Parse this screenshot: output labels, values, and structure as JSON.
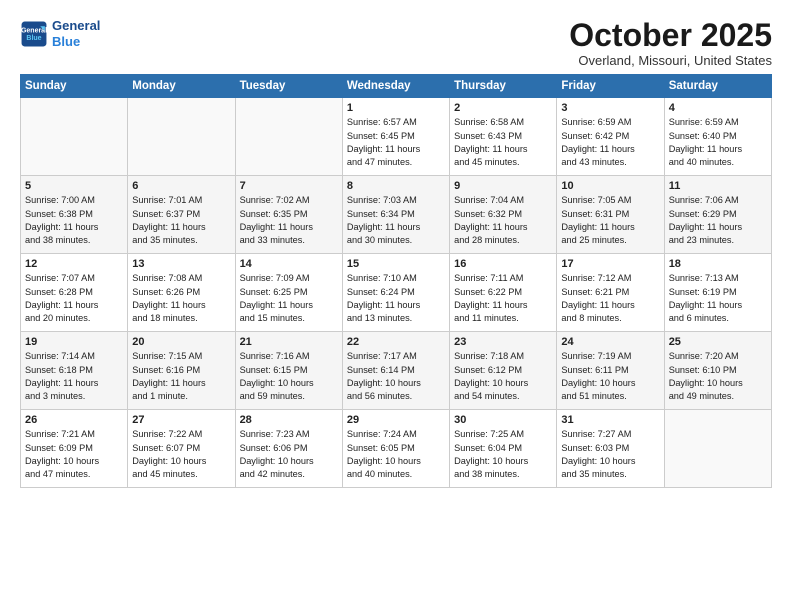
{
  "header": {
    "logo_line1": "General",
    "logo_line2": "Blue",
    "title": "October 2025",
    "location": "Overland, Missouri, United States"
  },
  "days_of_week": [
    "Sunday",
    "Monday",
    "Tuesday",
    "Wednesday",
    "Thursday",
    "Friday",
    "Saturday"
  ],
  "weeks": [
    [
      {
        "day": "",
        "info": ""
      },
      {
        "day": "",
        "info": ""
      },
      {
        "day": "",
        "info": ""
      },
      {
        "day": "1",
        "info": "Sunrise: 6:57 AM\nSunset: 6:45 PM\nDaylight: 11 hours\nand 47 minutes."
      },
      {
        "day": "2",
        "info": "Sunrise: 6:58 AM\nSunset: 6:43 PM\nDaylight: 11 hours\nand 45 minutes."
      },
      {
        "day": "3",
        "info": "Sunrise: 6:59 AM\nSunset: 6:42 PM\nDaylight: 11 hours\nand 43 minutes."
      },
      {
        "day": "4",
        "info": "Sunrise: 6:59 AM\nSunset: 6:40 PM\nDaylight: 11 hours\nand 40 minutes."
      }
    ],
    [
      {
        "day": "5",
        "info": "Sunrise: 7:00 AM\nSunset: 6:38 PM\nDaylight: 11 hours\nand 38 minutes."
      },
      {
        "day": "6",
        "info": "Sunrise: 7:01 AM\nSunset: 6:37 PM\nDaylight: 11 hours\nand 35 minutes."
      },
      {
        "day": "7",
        "info": "Sunrise: 7:02 AM\nSunset: 6:35 PM\nDaylight: 11 hours\nand 33 minutes."
      },
      {
        "day": "8",
        "info": "Sunrise: 7:03 AM\nSunset: 6:34 PM\nDaylight: 11 hours\nand 30 minutes."
      },
      {
        "day": "9",
        "info": "Sunrise: 7:04 AM\nSunset: 6:32 PM\nDaylight: 11 hours\nand 28 minutes."
      },
      {
        "day": "10",
        "info": "Sunrise: 7:05 AM\nSunset: 6:31 PM\nDaylight: 11 hours\nand 25 minutes."
      },
      {
        "day": "11",
        "info": "Sunrise: 7:06 AM\nSunset: 6:29 PM\nDaylight: 11 hours\nand 23 minutes."
      }
    ],
    [
      {
        "day": "12",
        "info": "Sunrise: 7:07 AM\nSunset: 6:28 PM\nDaylight: 11 hours\nand 20 minutes."
      },
      {
        "day": "13",
        "info": "Sunrise: 7:08 AM\nSunset: 6:26 PM\nDaylight: 11 hours\nand 18 minutes."
      },
      {
        "day": "14",
        "info": "Sunrise: 7:09 AM\nSunset: 6:25 PM\nDaylight: 11 hours\nand 15 minutes."
      },
      {
        "day": "15",
        "info": "Sunrise: 7:10 AM\nSunset: 6:24 PM\nDaylight: 11 hours\nand 13 minutes."
      },
      {
        "day": "16",
        "info": "Sunrise: 7:11 AM\nSunset: 6:22 PM\nDaylight: 11 hours\nand 11 minutes."
      },
      {
        "day": "17",
        "info": "Sunrise: 7:12 AM\nSunset: 6:21 PM\nDaylight: 11 hours\nand 8 minutes."
      },
      {
        "day": "18",
        "info": "Sunrise: 7:13 AM\nSunset: 6:19 PM\nDaylight: 11 hours\nand 6 minutes."
      }
    ],
    [
      {
        "day": "19",
        "info": "Sunrise: 7:14 AM\nSunset: 6:18 PM\nDaylight: 11 hours\nand 3 minutes."
      },
      {
        "day": "20",
        "info": "Sunrise: 7:15 AM\nSunset: 6:16 PM\nDaylight: 11 hours\nand 1 minute."
      },
      {
        "day": "21",
        "info": "Sunrise: 7:16 AM\nSunset: 6:15 PM\nDaylight: 10 hours\nand 59 minutes."
      },
      {
        "day": "22",
        "info": "Sunrise: 7:17 AM\nSunset: 6:14 PM\nDaylight: 10 hours\nand 56 minutes."
      },
      {
        "day": "23",
        "info": "Sunrise: 7:18 AM\nSunset: 6:12 PM\nDaylight: 10 hours\nand 54 minutes."
      },
      {
        "day": "24",
        "info": "Sunrise: 7:19 AM\nSunset: 6:11 PM\nDaylight: 10 hours\nand 51 minutes."
      },
      {
        "day": "25",
        "info": "Sunrise: 7:20 AM\nSunset: 6:10 PM\nDaylight: 10 hours\nand 49 minutes."
      }
    ],
    [
      {
        "day": "26",
        "info": "Sunrise: 7:21 AM\nSunset: 6:09 PM\nDaylight: 10 hours\nand 47 minutes."
      },
      {
        "day": "27",
        "info": "Sunrise: 7:22 AM\nSunset: 6:07 PM\nDaylight: 10 hours\nand 45 minutes."
      },
      {
        "day": "28",
        "info": "Sunrise: 7:23 AM\nSunset: 6:06 PM\nDaylight: 10 hours\nand 42 minutes."
      },
      {
        "day": "29",
        "info": "Sunrise: 7:24 AM\nSunset: 6:05 PM\nDaylight: 10 hours\nand 40 minutes."
      },
      {
        "day": "30",
        "info": "Sunrise: 7:25 AM\nSunset: 6:04 PM\nDaylight: 10 hours\nand 38 minutes."
      },
      {
        "day": "31",
        "info": "Sunrise: 7:27 AM\nSunset: 6:03 PM\nDaylight: 10 hours\nand 35 minutes."
      },
      {
        "day": "",
        "info": ""
      }
    ]
  ]
}
